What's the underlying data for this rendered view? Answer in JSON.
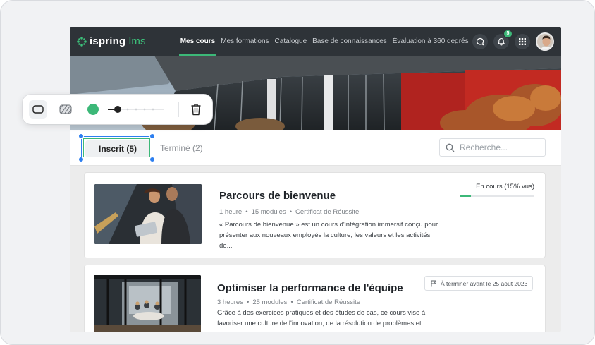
{
  "brand": {
    "name_part1": "ispring",
    "name_part2": "lms"
  },
  "nav": {
    "items": [
      {
        "label": "Mes cours",
        "active": true
      },
      {
        "label": "Mes formations",
        "active": false
      },
      {
        "label": "Catalogue",
        "active": false
      },
      {
        "label": "Base de connaissances",
        "active": false
      },
      {
        "label": "Évaluation à 360 degrés",
        "active": false
      }
    ],
    "more": "···",
    "notifications_count": "5"
  },
  "tabs": {
    "inscrit": "Inscrit (5)",
    "termine": "Terminé (2)"
  },
  "search": {
    "placeholder": "Recherche..."
  },
  "courses": [
    {
      "title": "Parcours de bienvenue",
      "duration": "1 heure",
      "modules": "15 modules",
      "certificate": "Certificat de Réussite",
      "description": "« Parcours de bienvenue » est un cours d'intégration immersif conçu pour présenter aux nouveaux employés la culture, les valeurs et les activités de...",
      "status": "En cours (15% vus)",
      "progress": 0.15
    },
    {
      "title": "Optimiser la performance de l'équipe",
      "duration": "3 heures",
      "modules": "25 modules",
      "certificate": "Certificat de Réussite",
      "description": "Grâce à des exercices pratiques et des études de cas, ce cours vise à favoriser une culture de l'innovation, de la résolution de problèmes et...",
      "deadline": "À terminer avant le 25 août 2023"
    }
  ],
  "toolbar": {
    "fill_color": "#3cb878",
    "stroke_level": 0.15,
    "icons": [
      "rectangle-icon",
      "hatch-pattern-icon",
      "color-swatch",
      "stroke-width-slider",
      "trash-icon"
    ]
  },
  "colors": {
    "accent": "#3cb878",
    "nav_bg": "#2e3338",
    "selection": "#2d7ff0"
  }
}
